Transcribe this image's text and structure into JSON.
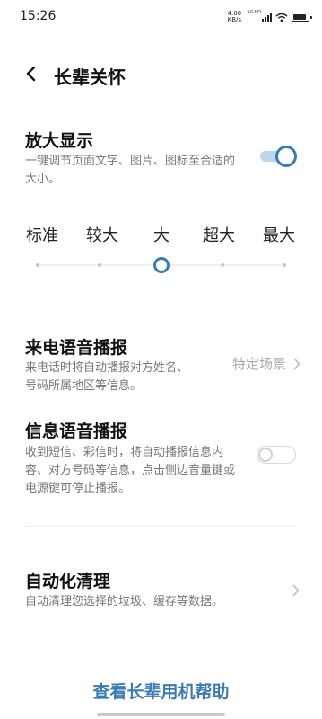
{
  "status_bar": {
    "time": "15:26",
    "net_speed_value": "4.00",
    "net_speed_unit": "KB/s",
    "signal_labels": [
      "5G",
      "HD"
    ]
  },
  "header": {
    "title": "长辈关怀",
    "back_icon": "chevron-left-icon"
  },
  "display_zoom": {
    "title": "放大显示",
    "description": "一键调节页面文字、图片、图标至合适的大小。",
    "enabled": true,
    "scale_options": [
      "标准",
      "较大",
      "大",
      "超大",
      "最大"
    ],
    "selected_index": 2
  },
  "incoming_call_voice": {
    "title": "来电语音播报",
    "description": "来电话时将自动播报对方姓名、号码所属地区等信息。",
    "value": "特定场景"
  },
  "message_voice": {
    "title": "信息语音播报",
    "description": "收到短信、彩信时，将自动播报信息内容、对方号码等信息，点击侧边音量键或电源键可停止播报。",
    "enabled": false
  },
  "auto_clean": {
    "title": "自动化清理",
    "description": "自动清理您选择的垃圾、缓存等数据。"
  },
  "footer": {
    "help_link": "查看长辈用机帮助"
  },
  "colors": {
    "accent": "#3b7bb3",
    "toggle_track_on": "#bcd6ea",
    "secondary_text": "#777777"
  }
}
